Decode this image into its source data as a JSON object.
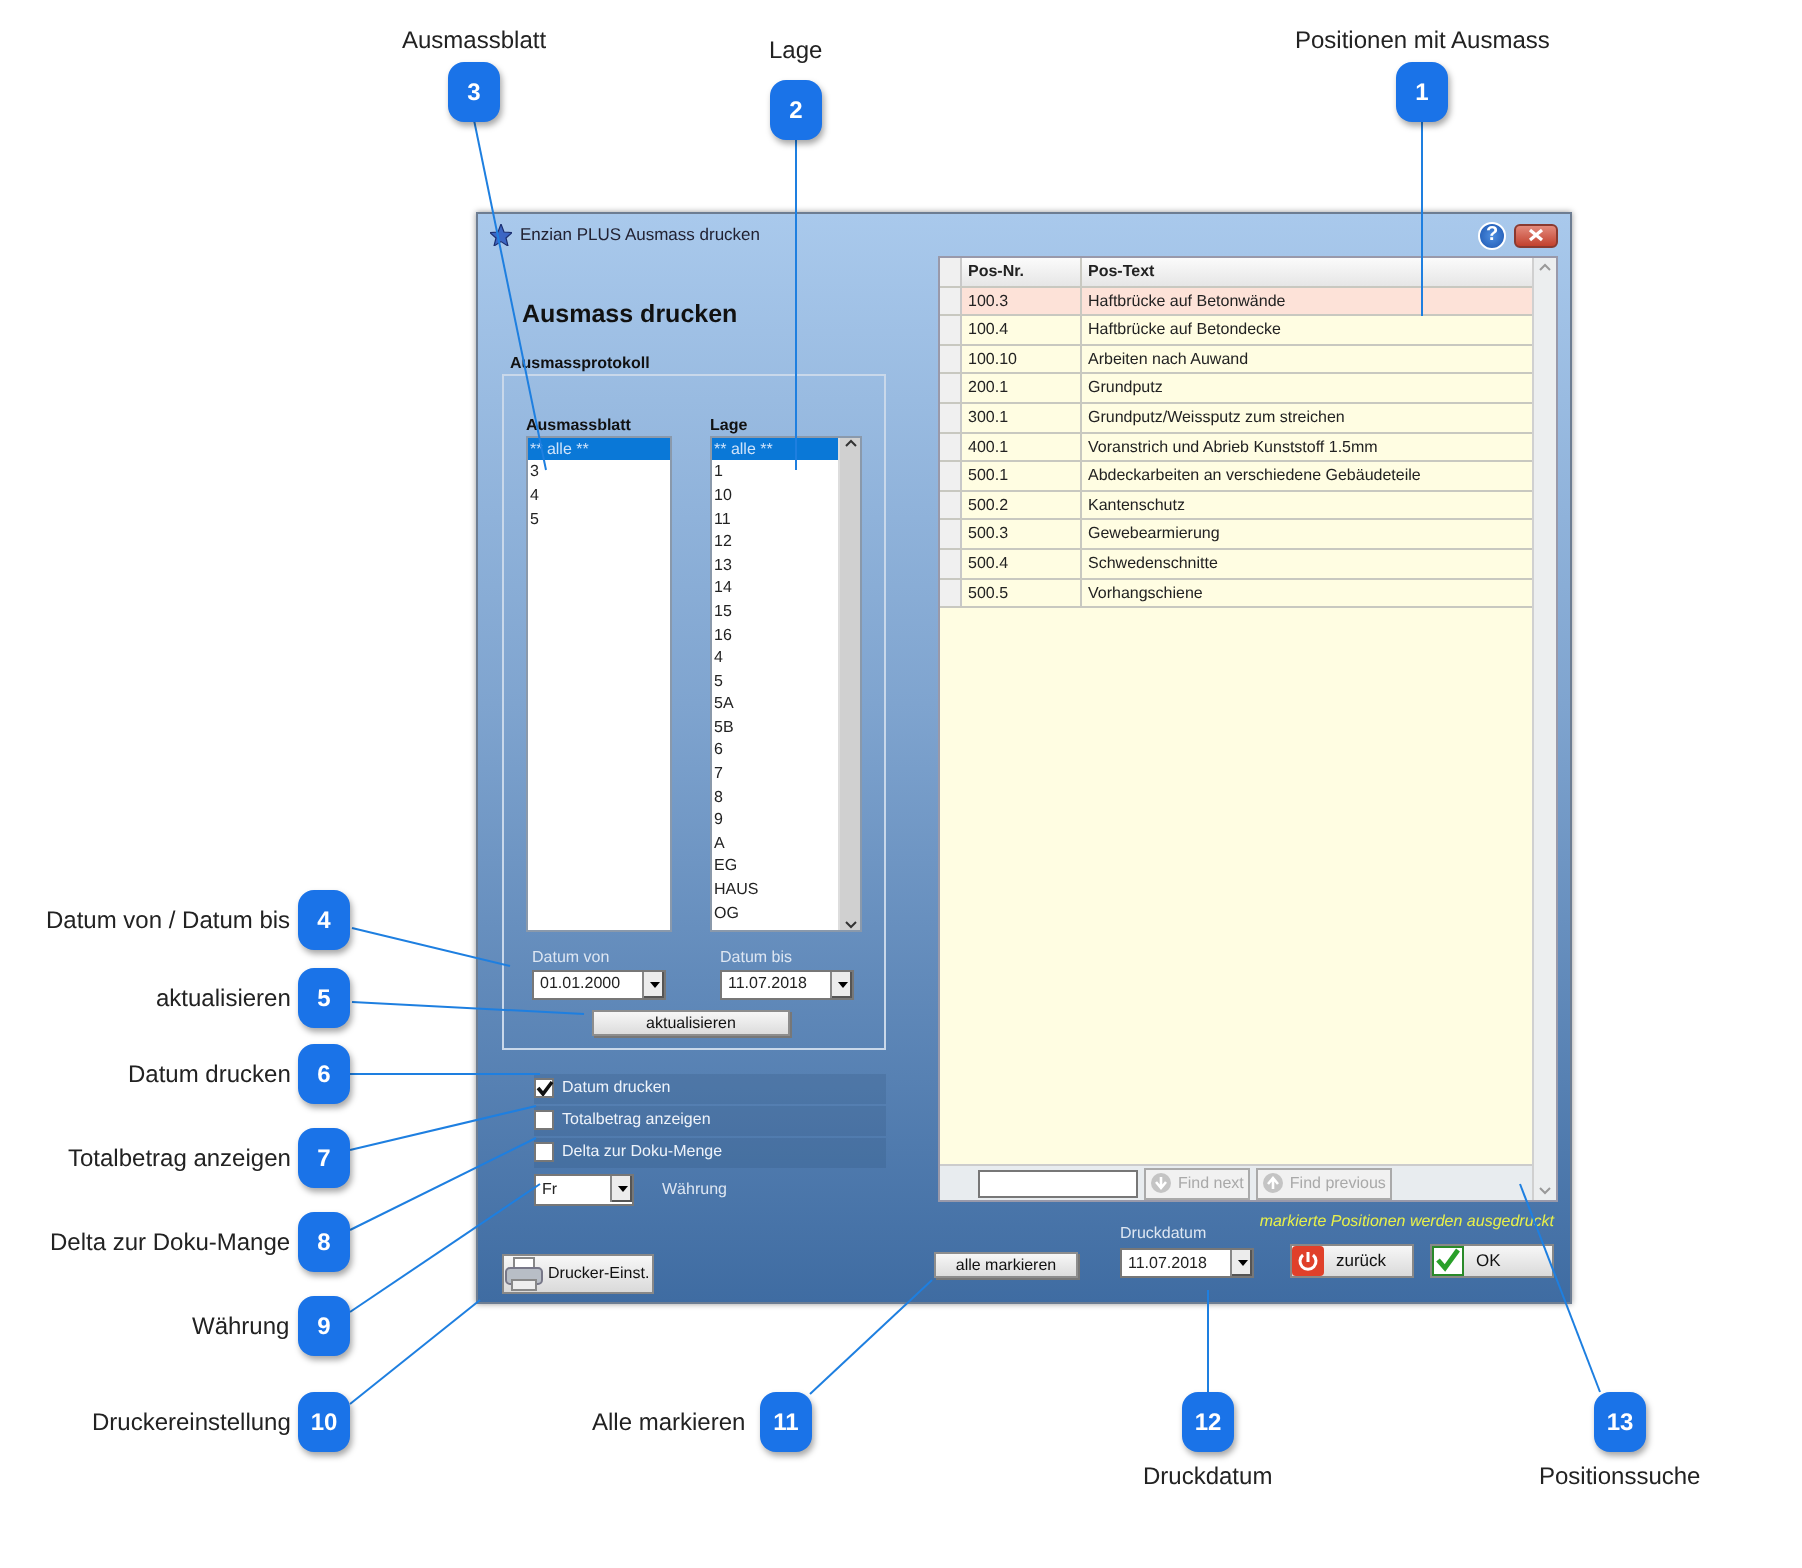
{
  "window": {
    "title": "Enzian PLUS Ausmass drucken",
    "help_button": "?"
  },
  "heading": "Ausmass drucken",
  "group_title": "Ausmassprotokoll",
  "ausmassblatt": {
    "label": "Ausmassblatt",
    "items": [
      {
        "text": "** alle **",
        "selected": true
      },
      {
        "text": "3",
        "selected": false
      },
      {
        "text": "4",
        "selected": false
      },
      {
        "text": "5",
        "selected": false
      }
    ]
  },
  "lage": {
    "label": "Lage",
    "items": [
      {
        "text": "** alle **",
        "selected": true
      },
      {
        "text": "1",
        "selected": false
      },
      {
        "text": "10",
        "selected": false
      },
      {
        "text": "11",
        "selected": false
      },
      {
        "text": "12",
        "selected": false
      },
      {
        "text": "13",
        "selected": false
      },
      {
        "text": "14",
        "selected": false
      },
      {
        "text": "15",
        "selected": false
      },
      {
        "text": "16",
        "selected": false
      },
      {
        "text": "4",
        "selected": false
      },
      {
        "text": "5",
        "selected": false
      },
      {
        "text": "5A",
        "selected": false
      },
      {
        "text": "5B",
        "selected": false
      },
      {
        "text": "6",
        "selected": false
      },
      {
        "text": "7",
        "selected": false
      },
      {
        "text": "8",
        "selected": false
      },
      {
        "text": "9",
        "selected": false
      },
      {
        "text": "A",
        "selected": false
      },
      {
        "text": "EG",
        "selected": false
      },
      {
        "text": "HAUS",
        "selected": false
      },
      {
        "text": "OG",
        "selected": false
      }
    ]
  },
  "datum_von": {
    "label": "Datum von",
    "value": "01.01.2000"
  },
  "datum_bis": {
    "label": "Datum bis",
    "value": "11.07.2018"
  },
  "refresh_button": "aktualisieren",
  "options": [
    {
      "label": "Datum drucken",
      "checked": true
    },
    {
      "label": "Totalbetrag anzeigen",
      "checked": false
    },
    {
      "label": "Delta zur Doku-Menge",
      "checked": false
    }
  ],
  "currency": {
    "value": "Fr",
    "label": "Währung"
  },
  "printer_button": "Drucker-Einst.",
  "table": {
    "columns": [
      "Pos-Nr.",
      "Pos-Text"
    ],
    "rows": [
      {
        "pos_nr": "100.3",
        "text": "Haftbrücke auf Betonwände",
        "selected": true
      },
      {
        "pos_nr": "100.4",
        "text": "Haftbrücke auf Betondecke",
        "selected": false
      },
      {
        "pos_nr": "100.10",
        "text": "Arbeiten nach Auwand",
        "selected": false
      },
      {
        "pos_nr": "200.1",
        "text": "Grundputz",
        "selected": false
      },
      {
        "pos_nr": "300.1",
        "text": "Grundputz/Weissputz zum streichen",
        "selected": false
      },
      {
        "pos_nr": "400.1",
        "text": "Voranstrich und Abrieb Kunststoff 1.5mm",
        "selected": false
      },
      {
        "pos_nr": "500.1",
        "text": "Abdeckarbeiten an verschiedene Gebäudeteile",
        "selected": false
      },
      {
        "pos_nr": "500.2",
        "text": "Kantenschutz",
        "selected": false
      },
      {
        "pos_nr": "500.3",
        "text": "Gewebearmierung",
        "selected": false
      },
      {
        "pos_nr": "500.4",
        "text": "Schwedenschnitte",
        "selected": false
      },
      {
        "pos_nr": "500.5",
        "text": "Vorhangschiene",
        "selected": false
      }
    ]
  },
  "search": {
    "buttons": [
      {
        "label": "Find next",
        "disabled": true
      },
      {
        "label": "Find previous",
        "disabled": true
      }
    ]
  },
  "hint": "markierte Positionen werden ausgedruckt",
  "select_all_button": "alle markieren",
  "druckdatum": {
    "label": "Druckdatum",
    "value": "11.07.2018"
  },
  "buttons": [
    {
      "label": "zurück",
      "kind": "cancel"
    },
    {
      "label": "OK",
      "kind": "ok"
    }
  ],
  "callouts": [
    {
      "number": "3",
      "label": "Ausmassblatt"
    },
    {
      "number": "2",
      "label": "Lage"
    },
    {
      "number": "1",
      "label": "Positionen mit Ausmass"
    },
    {
      "number": "4",
      "label": "Datum von / Datum bis"
    },
    {
      "number": "5",
      "label": "aktualisieren"
    },
    {
      "number": "6",
      "label": "Datum drucken"
    },
    {
      "number": "7",
      "label": "Totalbetrag anzeigen"
    },
    {
      "number": "8",
      "label": "Delta zur Doku-Mange"
    },
    {
      "number": "9",
      "label": "Währung"
    },
    {
      "number": "10",
      "label": "Druckereinstellung"
    },
    {
      "number": "11",
      "label": "Alle markieren"
    },
    {
      "number": "12",
      "label": "Druckdatum"
    },
    {
      "number": "13",
      "label": "Positionssuche"
    }
  ]
}
